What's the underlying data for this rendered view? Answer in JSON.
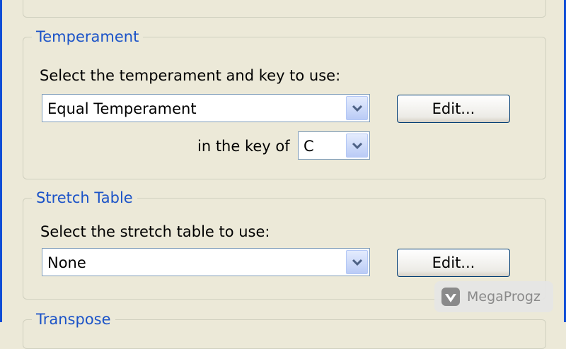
{
  "temperament": {
    "title": "Temperament",
    "prompt": "Select the temperament and key to use:",
    "selected": "Equal Temperament",
    "edit_label": "Edit...",
    "key_label": "in the key of",
    "key_value": "C"
  },
  "stretch": {
    "title": "Stretch Table",
    "prompt": "Select the stretch table to use:",
    "selected": "None",
    "edit_label": "Edit..."
  },
  "transpose": {
    "title": "Transpose"
  },
  "watermark": {
    "text": "MegaProgz"
  },
  "colors": {
    "dialog_bg": "#ECE9D8",
    "group_title": "#1B53C8",
    "window_frame": "#0F4DD6"
  },
  "icons": {
    "combo_arrow": "chevron-down-icon",
    "watermark_logo": "megaprogz-logo"
  }
}
